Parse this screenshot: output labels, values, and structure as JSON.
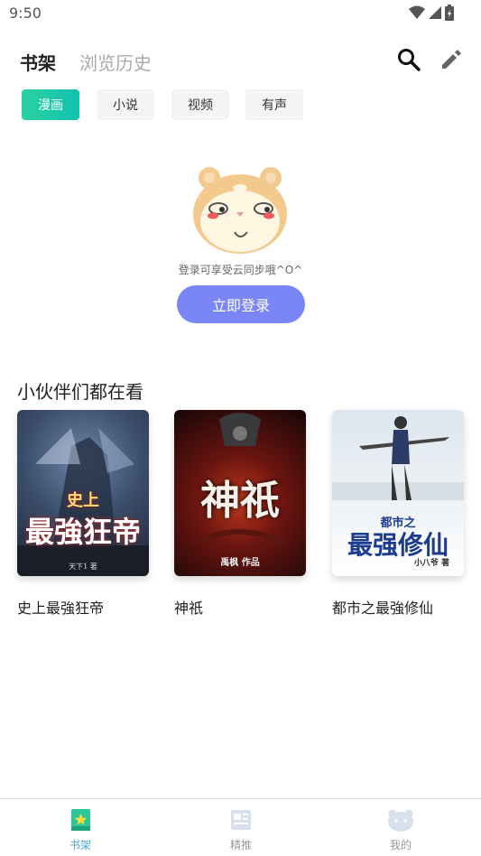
{
  "status_bar": {
    "time": "9:50"
  },
  "header": {
    "tabs": [
      "书架",
      "浏览历史"
    ]
  },
  "categories": [
    "漫画",
    "小说",
    "视频",
    "有声"
  ],
  "login": {
    "tip": "登录可享受云同步哦^O^",
    "button": "立即登录"
  },
  "recommend": {
    "title": "小伙伴们都在看",
    "books": [
      {
        "title": "史上最強狂帝",
        "cover_main": "史上\n最強狂帝",
        "cover_small": "天下1 著"
      },
      {
        "title": "神祇",
        "cover_main": "神祇",
        "cover_small": "禹枫 作品"
      },
      {
        "title": "都市之最強修仙",
        "cover_main": "最强修仙",
        "cover_top": "都市之",
        "cover_small": "小八爷 著"
      }
    ]
  },
  "bottom_nav": [
    "书架",
    "精推",
    "我的"
  ],
  "colors": {
    "accent": "#12c3b0",
    "login_button": "#7b86f6",
    "nav_active": "#4aa7d8"
  }
}
